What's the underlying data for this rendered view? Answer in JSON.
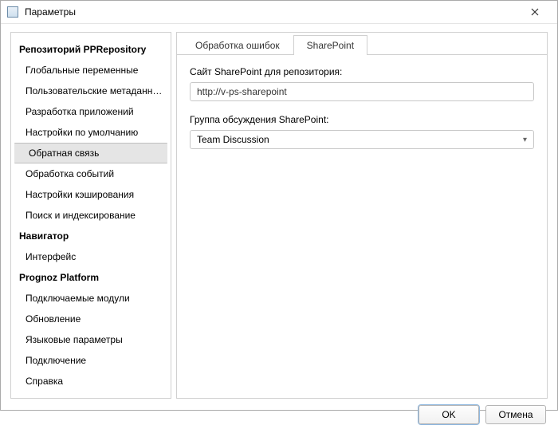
{
  "window": {
    "title": "Параметры"
  },
  "sidebar": {
    "section1_title": "Репозиторий  PPRepository",
    "section1_items": [
      "Глобальные переменные",
      "Пользовательские метаданные",
      "Разработка приложений",
      "Настройки по умолчанию",
      "Обратная связь",
      "Обработка событий",
      "Настройки кэширования",
      "Поиск и индексирование"
    ],
    "section1_selected_index": 4,
    "section2_title": "Навигатор",
    "section2_items": [
      "Интерфейс"
    ],
    "section3_title": "Prognoz Platform",
    "section3_items": [
      "Подключаемые модули",
      "Обновление",
      "Языковые параметры",
      "Подключение",
      "Справка"
    ]
  },
  "tabs": {
    "items": [
      "Обработка ошибок",
      "SharePoint"
    ],
    "active_index": 1
  },
  "form": {
    "site_label": "Сайт SharePoint для репозитория:",
    "site_value": "http://v-ps-sharepoint",
    "group_label": "Группа обсуждения SharePoint:",
    "group_value": "Team Discussion"
  },
  "footer": {
    "ok": "OK",
    "cancel": "Отмена"
  }
}
